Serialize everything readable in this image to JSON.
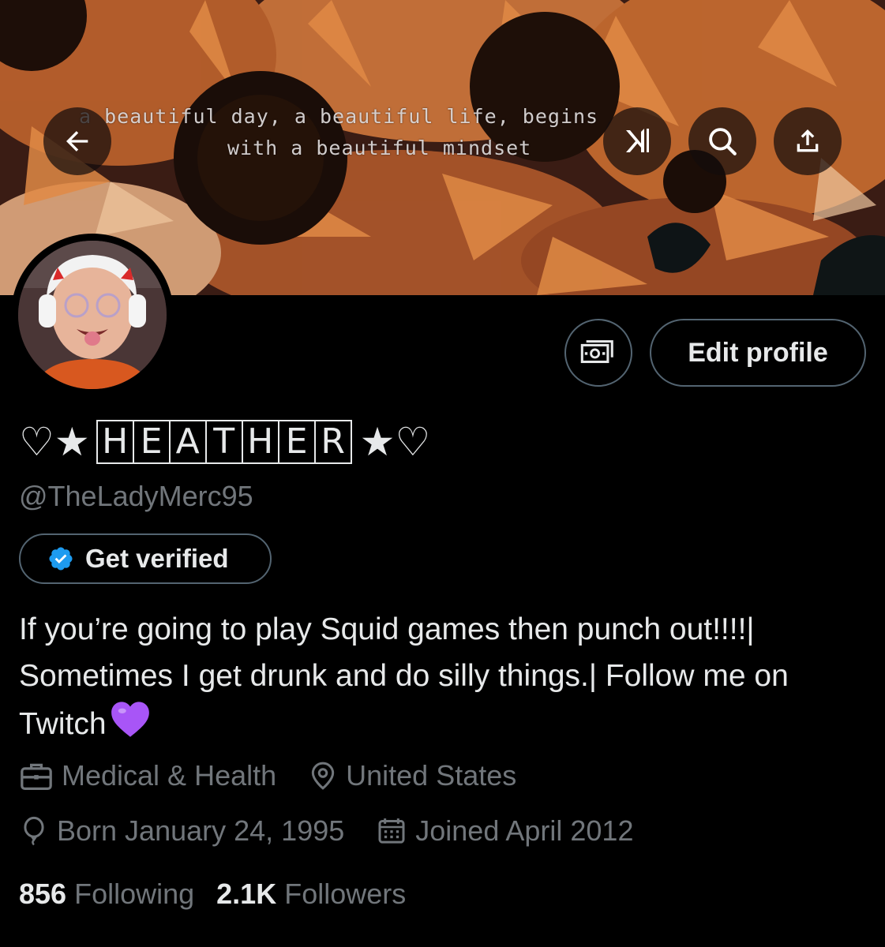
{
  "header": {
    "banner_quote_line1": "a beautiful day, a beautiful life, begins",
    "banner_quote_line2": "with a beautiful mindset",
    "back_icon": "arrow-left-icon",
    "grok_icon": "grok-icon",
    "search_icon": "search-icon",
    "share_icon": "share-icon"
  },
  "profile": {
    "name_prefix": "♡★",
    "name_letters": [
      "H",
      "E",
      "A",
      "T",
      "H",
      "E",
      "R"
    ],
    "name_suffix": "★♡",
    "handle": "@TheLadyMerc95",
    "edit_profile_label": "Edit profile",
    "get_verified_label": "Get verified",
    "bio": "If you’re going to play Squid games then punch out!!!!| Sometimes I get drunk and do silly things.| Follow me on Twitch",
    "bio_emoji": "purple-heart-icon",
    "category": "Medical & Health",
    "location": "United States",
    "birthday": "Born January 24, 1995",
    "joined": "Joined April 2012",
    "following_count": "856",
    "following_label": "Following",
    "followers_count": "2.1K",
    "followers_label": "Followers"
  },
  "colors": {
    "background": "#000000",
    "primary_text": "#e7e9ea",
    "secondary_text": "#71767b",
    "border": "#536471",
    "verified_blue": "#1d9bf0",
    "heart_purple": "#a855f7"
  }
}
